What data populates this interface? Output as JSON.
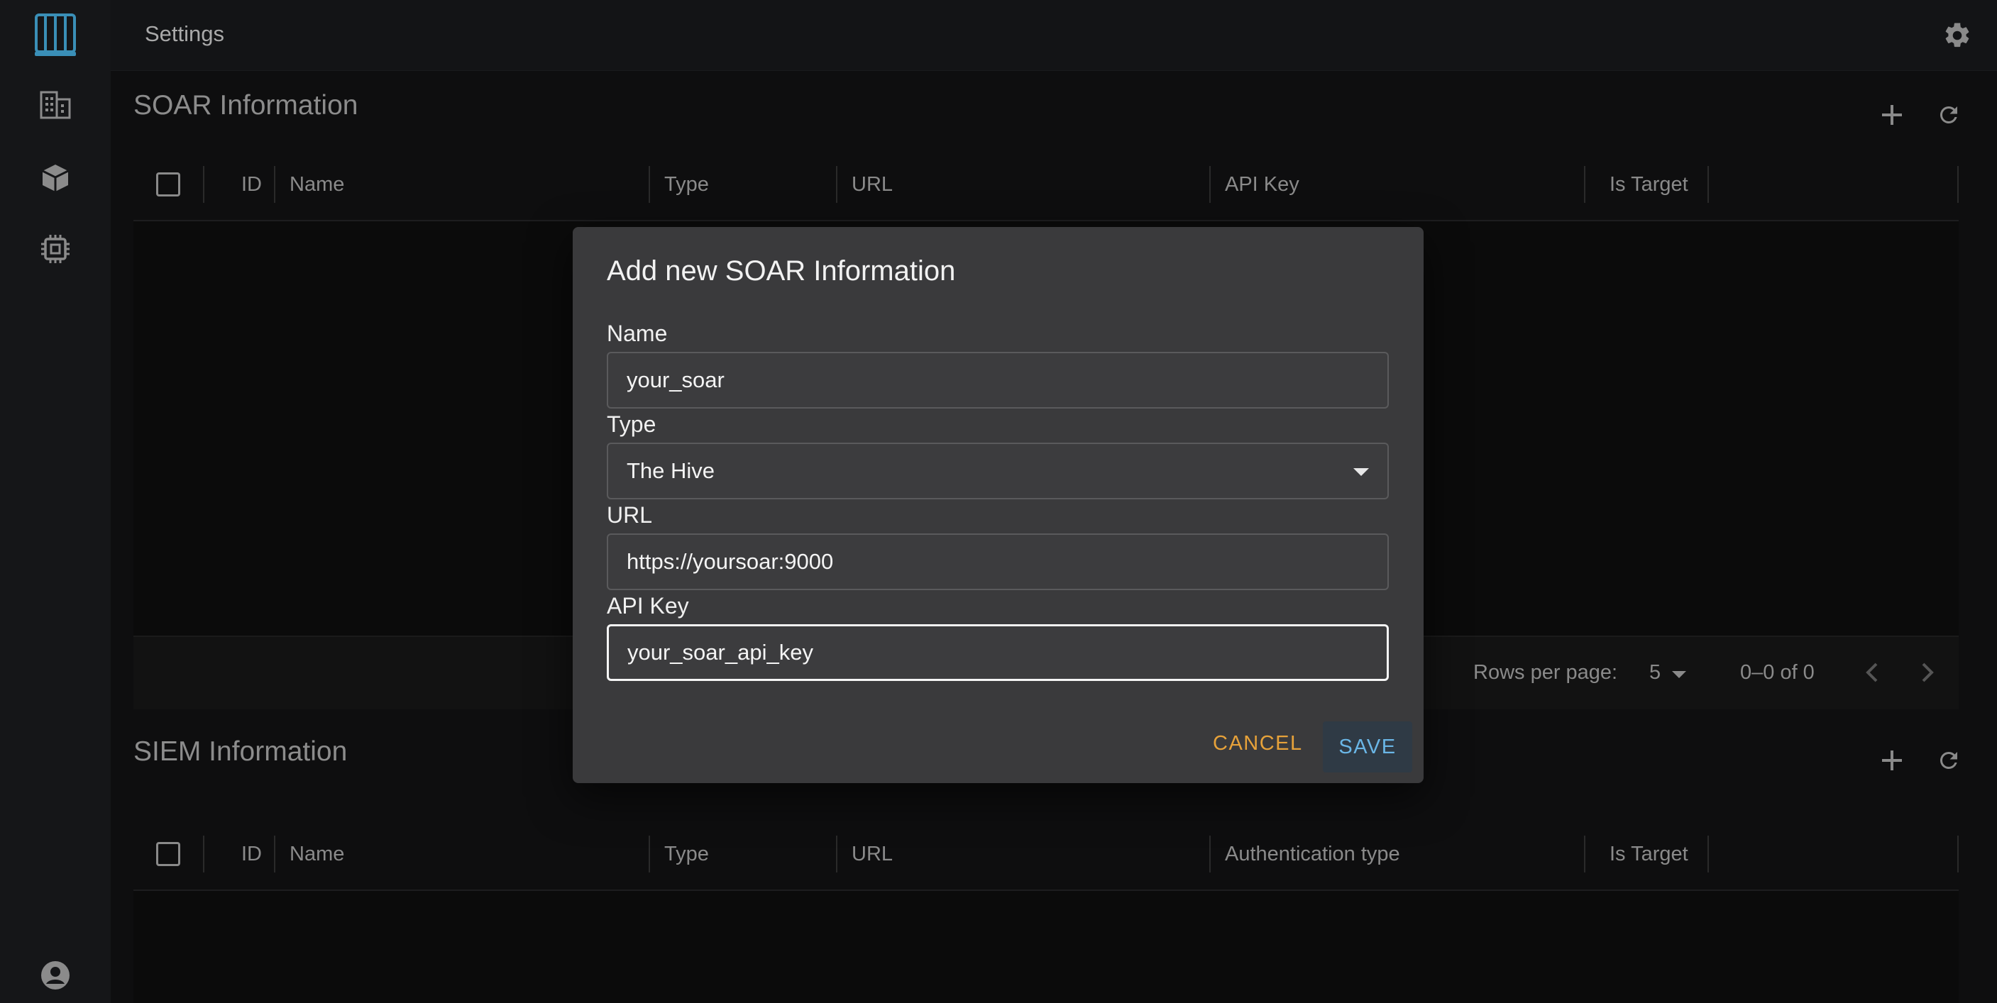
{
  "topbar": {
    "title": "Settings",
    "settings_icon": "gear-icon"
  },
  "sidebar": {
    "items": [
      {
        "name": "logo",
        "icon": "logo-icon"
      },
      {
        "name": "dashboard",
        "icon": "building-icon"
      },
      {
        "name": "modules",
        "icon": "cube-icon"
      },
      {
        "name": "hardware",
        "icon": "chip-icon"
      },
      {
        "name": "account",
        "icon": "account-circle-icon"
      }
    ]
  },
  "soar": {
    "title": "SOAR Information",
    "columns": [
      "ID",
      "Name",
      "Type",
      "URL",
      "API Key",
      "Is Target"
    ],
    "pagination": {
      "rows_per_page_label": "Rows per page:",
      "rows_per_page": "5",
      "range": "0–0 of 0"
    }
  },
  "siem": {
    "title": "SIEM Information",
    "columns": [
      "ID",
      "Name",
      "Type",
      "URL",
      "Authentication type",
      "Is Target"
    ]
  },
  "modal": {
    "title": "Add new SOAR Information",
    "fields": {
      "name": {
        "label": "Name",
        "value": "your_soar"
      },
      "type": {
        "label": "Type",
        "value": "The Hive"
      },
      "url": {
        "label": "URL",
        "value": "https://yoursoar:9000"
      },
      "api_key": {
        "label": "API Key",
        "value": "your_soar_api_key"
      }
    },
    "cancel_label": "CANCEL",
    "save_label": "SAVE"
  },
  "colors": {
    "accent_cancel": "#e7a23a",
    "accent_save": "#6ab6e6",
    "logo": "#3a8fb7"
  }
}
